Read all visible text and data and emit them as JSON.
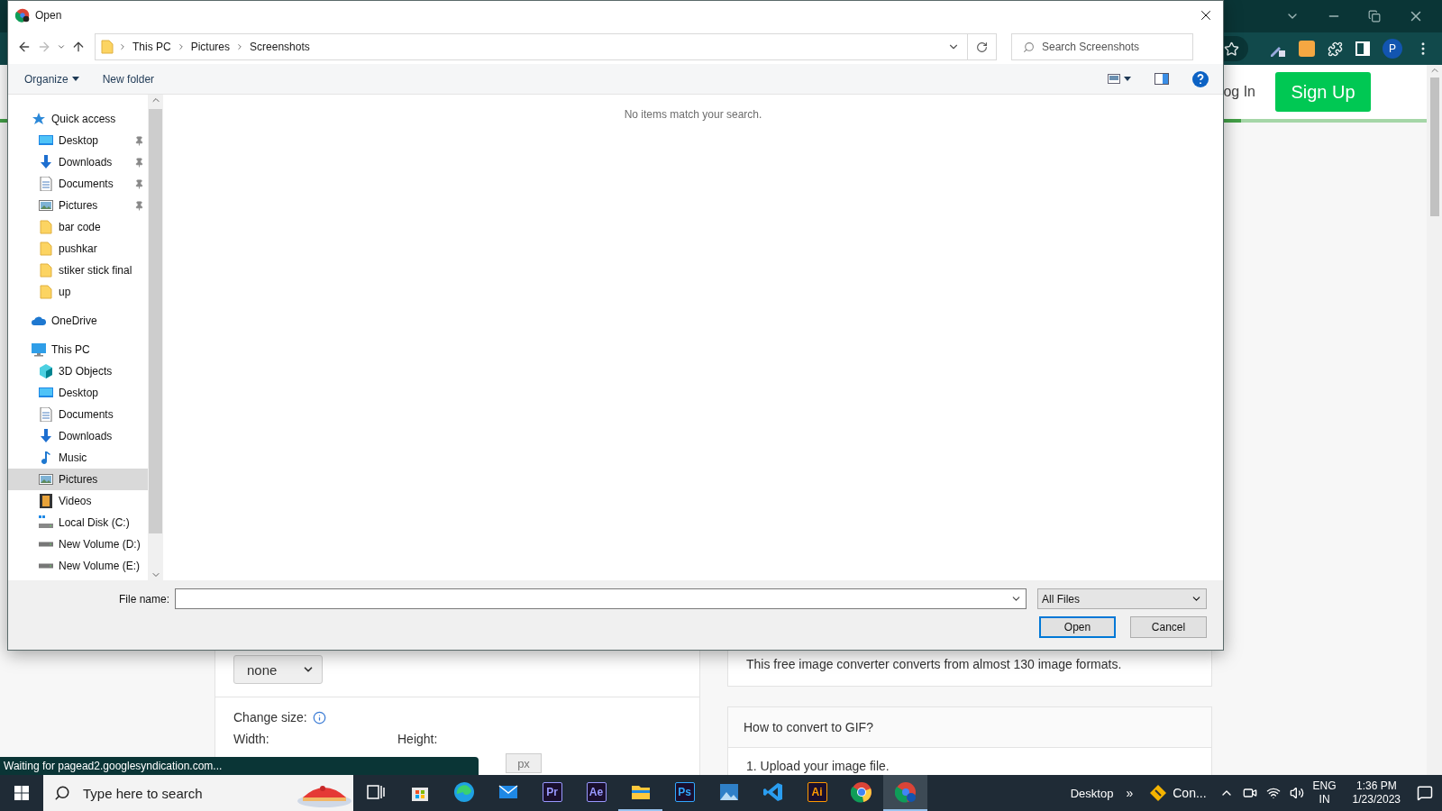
{
  "browser": {
    "profile": "P",
    "page": {
      "login": "og In",
      "signup": "Sign Up",
      "progress": {
        "level": 0.87
      },
      "left": {
        "select": "none",
        "change_size": "Change size:",
        "width_label": "Width:",
        "height_label": "Height:",
        "unit": "px"
      },
      "right": {
        "card_text": "This free image converter converts from almost 130 image formats.",
        "howto_title": "How to convert to GIF?",
        "howto_step": "1. Upload your image file."
      }
    },
    "status": "Waiting for pagead2.googlesyndication.com..."
  },
  "dialog": {
    "title": "Open",
    "nav_buttons": [
      {
        "kind": "back",
        "disabled": false
      },
      {
        "kind": "forward",
        "disabled": true
      },
      {
        "kind": "recent",
        "disabled": false
      },
      {
        "kind": "up",
        "disabled": false
      }
    ],
    "breadcrumb": [
      "This PC",
      "Pictures",
      "Screenshots"
    ],
    "search": {
      "placeholder": "Search Screenshots"
    },
    "toolbar": {
      "organize": "Organize",
      "new_folder": "New folder"
    },
    "nav": [
      {
        "label": "Quick access",
        "kind": "star",
        "selected": false,
        "children": [
          {
            "label": "Desktop",
            "kind": "desktop",
            "pinned": true,
            "selected": false
          },
          {
            "label": "Downloads",
            "kind": "downloads",
            "pinned": true,
            "selected": false
          },
          {
            "label": "Documents",
            "kind": "documents",
            "pinned": true,
            "selected": false
          },
          {
            "label": "Pictures",
            "kind": "pictures",
            "pinned": true,
            "selected": false
          },
          {
            "label": "bar code",
            "kind": "folder",
            "pinned": false,
            "selected": false
          },
          {
            "label": "pushkar",
            "kind": "folder",
            "pinned": false,
            "selected": false
          },
          {
            "label": "stiker stick final",
            "kind": "folder",
            "pinned": false,
            "selected": false
          },
          {
            "label": "up",
            "kind": "folder",
            "pinned": false,
            "selected": false
          }
        ]
      },
      {
        "label": "OneDrive",
        "kind": "cloud",
        "selected": false
      },
      {
        "label": "This PC",
        "kind": "pc",
        "selected": false,
        "children": [
          {
            "label": "3D Objects",
            "kind": "cube",
            "pinned": false,
            "selected": false
          },
          {
            "label": "Desktop",
            "kind": "desktop",
            "pinned": false,
            "selected": false
          },
          {
            "label": "Documents",
            "kind": "documents",
            "pinned": false,
            "selected": false
          },
          {
            "label": "Downloads",
            "kind": "downloads",
            "pinned": false,
            "selected": false
          },
          {
            "label": "Music",
            "kind": "music",
            "pinned": false,
            "selected": false
          },
          {
            "label": "Pictures",
            "kind": "pictures",
            "pinned": false,
            "selected": true
          },
          {
            "label": "Videos",
            "kind": "videos",
            "pinned": false,
            "selected": false
          },
          {
            "label": "Local Disk (C:)",
            "kind": "system-disk",
            "pinned": false,
            "selected": false
          },
          {
            "label": "New Volume (D:)",
            "kind": "disk",
            "pinned": false,
            "selected": false
          },
          {
            "label": "New Volume (E:)",
            "kind": "disk",
            "pinned": false,
            "selected": false
          }
        ]
      }
    ],
    "empty_message": "No items match your search.",
    "file_name_label": "File name:",
    "file_type": "All Files",
    "buttons": [
      {
        "label": "Open",
        "default": true
      },
      {
        "label": "Cancel",
        "default": false
      }
    ]
  },
  "taskbar": {
    "search_placeholder": "Type here to search",
    "apps": [
      {
        "kind": "task-view",
        "running": false,
        "selected": false
      },
      {
        "kind": "store",
        "running": false,
        "selected": false
      },
      {
        "kind": "edge",
        "running": false,
        "selected": false
      },
      {
        "kind": "mail",
        "running": false,
        "selected": false
      },
      {
        "kind": "letter",
        "label": "Pr",
        "color": "#9999ff",
        "running": false,
        "selected": false
      },
      {
        "kind": "letter",
        "label": "Ae",
        "color": "#9999ff",
        "running": false,
        "selected": false
      },
      {
        "kind": "explorer",
        "running": true,
        "selected": false
      },
      {
        "kind": "letter",
        "label": "Ps",
        "color": "#31a8ff",
        "running": false,
        "selected": false
      },
      {
        "kind": "photos",
        "running": false,
        "selected": false
      },
      {
        "kind": "vscode",
        "running": false,
        "selected": false
      },
      {
        "kind": "letter",
        "label": "Ai",
        "color": "#ff9a00",
        "running": false,
        "selected": false
      },
      {
        "kind": "chrome",
        "running": false,
        "selected": false
      },
      {
        "kind": "chrome-profile",
        "running": true,
        "selected": true
      }
    ],
    "desktop_label": "Desktop",
    "more": "»",
    "tray_app": "Con...",
    "lang": "ENG",
    "region": "IN",
    "time": "1:36 PM",
    "date": "1/23/2023"
  }
}
